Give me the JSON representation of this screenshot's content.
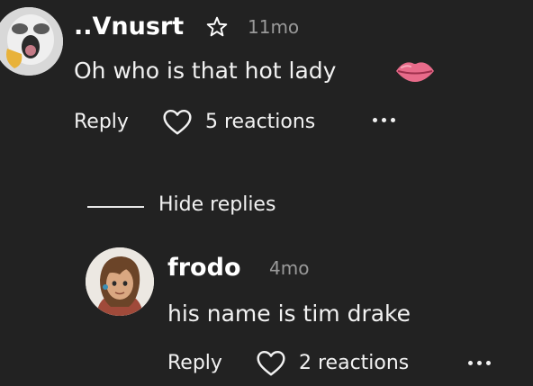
{
  "colors": {
    "background": "#222222",
    "text": "#f2f2f2",
    "muted": "#9a9a9a"
  },
  "comment": {
    "username": "..Vnusrt",
    "badge_icon": "star-outline-icon",
    "time": "11mo",
    "text": "Oh who is that hot lady",
    "emoji_icon": "lips-icon",
    "reply_label": "Reply",
    "reactions_label": "5 reactions",
    "heart_icon": "heart-outline-icon",
    "more_icon": "more-dots-icon"
  },
  "thread": {
    "toggle_label": "Hide replies"
  },
  "reply": {
    "username": "frodo",
    "time": "4mo",
    "text": "his name is tim drake",
    "reply_label": "Reply",
    "reactions_label": "2 reactions",
    "heart_icon": "heart-outline-icon",
    "more_icon": "more-dots-icon"
  }
}
